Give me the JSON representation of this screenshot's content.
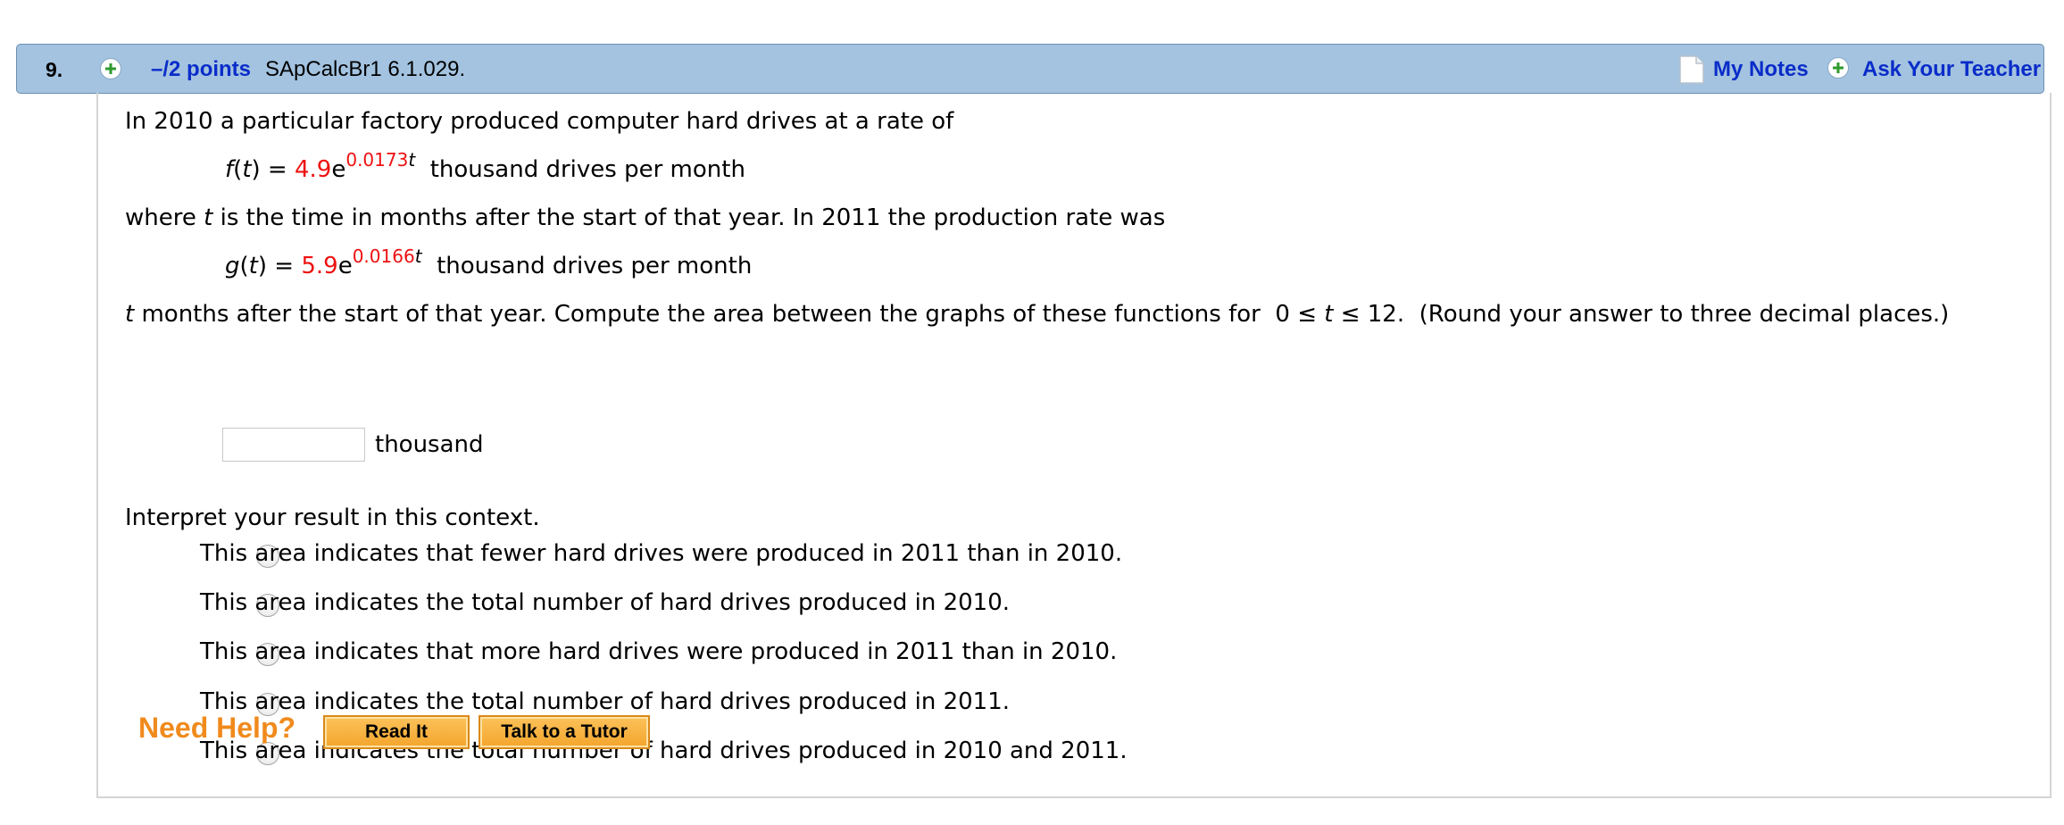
{
  "header": {
    "number": "9.",
    "points": "–/2 points",
    "source": "SApCalcBr1 6.1.029.",
    "my_notes": "My Notes",
    "ask_teacher": "Ask Your Teacher"
  },
  "question": {
    "intro": "In 2010 a particular factory produced computer hard drives at a rate of",
    "f": {
      "name": "f",
      "var": "t",
      "coef": "4.9",
      "base": "e",
      "exp_num": "0.0173",
      "exp_var": "t",
      "units": "thousand drives per month"
    },
    "mid_a": "where ",
    "mid_var": "t",
    "mid_b": " is the time in months after the start of that year. In 2011 the production rate was",
    "g": {
      "name": "g",
      "var": "t",
      "coef": "5.9",
      "base": "e",
      "exp_num": "0.0166",
      "exp_var": "t",
      "units": "thousand drives per month"
    },
    "last_var": "t",
    "last_a": " months after the start of that year. Compute the area between the graphs of these functions for ",
    "range_lo": "0 ≤ ",
    "range_var": "t",
    "range_hi": " ≤ 12.",
    "last_b": "(Round your answer to three decimal places.)",
    "answer_value": "",
    "answer_units": "thousand",
    "interpret_prompt": "Interpret your result in this context.",
    "options": [
      "This area indicates that fewer hard drives were produced in 2011 than in 2010.",
      "This area indicates the total number of hard drives produced in 2010.",
      "This area indicates that more hard drives were produced in 2011 than in 2010.",
      "This area indicates the total number of hard drives produced in 2011.",
      "This area indicates the total number of hard drives produced in 2010 and 2011."
    ]
  },
  "help": {
    "label": "Need Help?",
    "read_it": "Read It",
    "talk_tutor": "Talk to a Tutor"
  },
  "colors": {
    "header_bg": "#a3c3e0",
    "link_blue": "#0a2cc9",
    "value_red": "#ee1111",
    "help_orange": "#f08a1c",
    "plus_green": "#2e9a2e"
  },
  "icons": {
    "points_toggle": "plus-circle-icon",
    "notes": "note-page-icon",
    "ask_teacher": "plus-circle-icon"
  }
}
